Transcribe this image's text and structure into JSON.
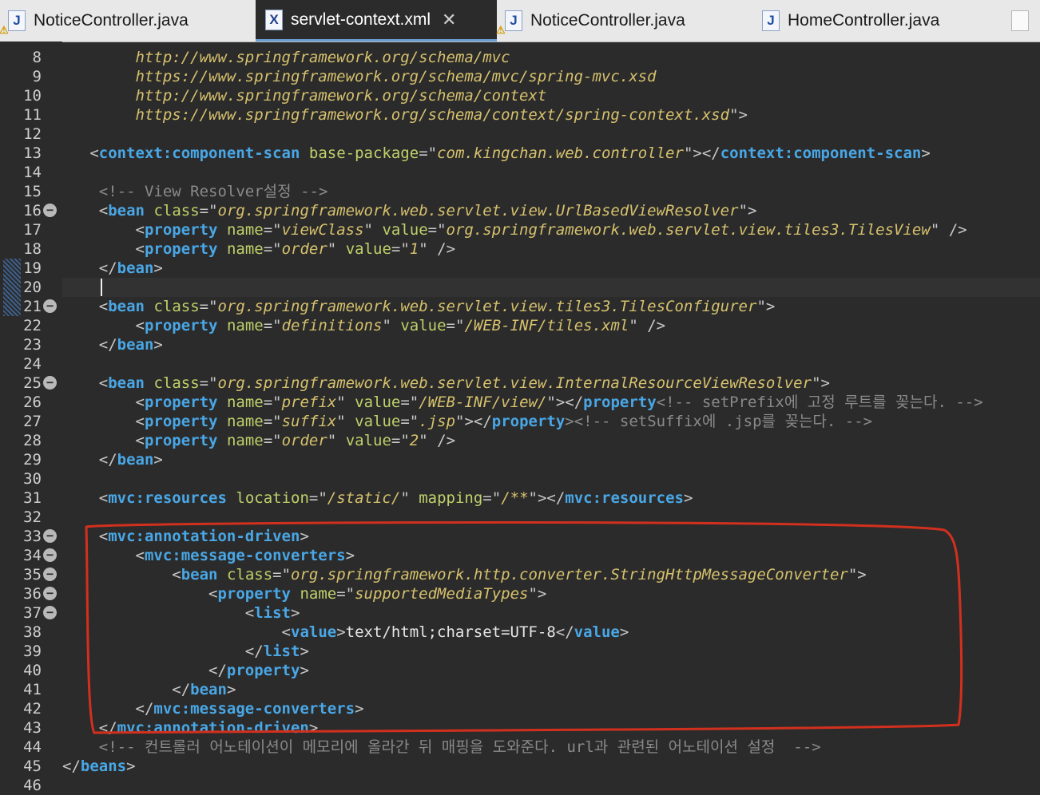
{
  "tabs": [
    {
      "label": "NoticeController.java",
      "icon": "java-file-icon"
    },
    {
      "label": "servlet-context.xml",
      "icon": "xml-file-icon"
    },
    {
      "label": "NoticeController.java",
      "icon": "java-file-icon"
    },
    {
      "label": "HomeController.java",
      "icon": "java-file-icon"
    }
  ],
  "active_tab_index": 1,
  "tab_icon_letters": {
    "java": "J",
    "xml": "X"
  },
  "close_glyph": "✕",
  "code_lines": [
    {
      "n": "8",
      "parts": [
        [
          "t",
          "        "
        ],
        [
          "v",
          "http://www.springframework.org/schema/mvc"
        ]
      ]
    },
    {
      "n": "9",
      "parts": [
        [
          "t",
          "        "
        ],
        [
          "v",
          "https://www.springframework.org/schema/mvc/spring-mvc.xsd"
        ]
      ]
    },
    {
      "n": "10",
      "parts": [
        [
          "t",
          "        "
        ],
        [
          "v",
          "http://www.springframework.org/schema/context"
        ]
      ]
    },
    {
      "n": "11",
      "parts": [
        [
          "t",
          "        "
        ],
        [
          "v",
          "https://www.springframework.org/schema/context/spring-context.xsd"
        ],
        [
          "b",
          "\">"
        ]
      ]
    },
    {
      "n": "12",
      "parts": []
    },
    {
      "n": "13",
      "parts": [
        [
          "t",
          "   "
        ],
        [
          "b",
          "<"
        ],
        [
          "g",
          "context:component-scan"
        ],
        [
          "t",
          " "
        ],
        [
          "a",
          "base-package"
        ],
        [
          "b",
          "=\""
        ],
        [
          "v",
          "com.kingchan.web.controller"
        ],
        [
          "b",
          "\"></"
        ],
        [
          "g",
          "context:component-scan"
        ],
        [
          "b",
          ">"
        ]
      ]
    },
    {
      "n": "14",
      "parts": []
    },
    {
      "n": "15",
      "parts": [
        [
          "t",
          "    "
        ],
        [
          "c",
          "<!-- View Resolver설정 -->"
        ]
      ]
    },
    {
      "n": "16",
      "fold": true,
      "parts": [
        [
          "t",
          "    "
        ],
        [
          "b",
          "<"
        ],
        [
          "g",
          "bean"
        ],
        [
          "t",
          " "
        ],
        [
          "a",
          "class"
        ],
        [
          "b",
          "=\""
        ],
        [
          "v",
          "org.springframework.web.servlet.view.UrlBasedViewResolver"
        ],
        [
          "b",
          "\">"
        ]
      ]
    },
    {
      "n": "17",
      "parts": [
        [
          "t",
          "        "
        ],
        [
          "b",
          "<"
        ],
        [
          "g",
          "property"
        ],
        [
          "t",
          " "
        ],
        [
          "a",
          "name"
        ],
        [
          "b",
          "=\""
        ],
        [
          "v",
          "viewClass"
        ],
        [
          "b",
          "\""
        ],
        [
          "t",
          " "
        ],
        [
          "a",
          "value"
        ],
        [
          "b",
          "=\""
        ],
        [
          "v",
          "org.springframework.web.servlet.view.tiles3.TilesView"
        ],
        [
          "b",
          "\" />"
        ]
      ]
    },
    {
      "n": "18",
      "parts": [
        [
          "t",
          "        "
        ],
        [
          "b",
          "<"
        ],
        [
          "g",
          "property"
        ],
        [
          "t",
          " "
        ],
        [
          "a",
          "name"
        ],
        [
          "b",
          "=\""
        ],
        [
          "v",
          "order"
        ],
        [
          "b",
          "\""
        ],
        [
          "t",
          " "
        ],
        [
          "a",
          "value"
        ],
        [
          "b",
          "=\""
        ],
        [
          "v",
          "1"
        ],
        [
          "b",
          "\" />"
        ]
      ]
    },
    {
      "n": "19",
      "parts": [
        [
          "t",
          "    "
        ],
        [
          "b",
          "</"
        ],
        [
          "g",
          "bean"
        ],
        [
          "b",
          ">"
        ]
      ]
    },
    {
      "n": "20",
      "cursor": true,
      "parts": []
    },
    {
      "n": "21",
      "fold": true,
      "parts": [
        [
          "t",
          "    "
        ],
        [
          "b",
          "<"
        ],
        [
          "g",
          "bean"
        ],
        [
          "t",
          " "
        ],
        [
          "a",
          "class"
        ],
        [
          "b",
          "=\""
        ],
        [
          "v",
          "org.springframework.web.servlet.view.tiles3.TilesConfigurer"
        ],
        [
          "b",
          "\">"
        ]
      ]
    },
    {
      "n": "22",
      "parts": [
        [
          "t",
          "        "
        ],
        [
          "b",
          "<"
        ],
        [
          "g",
          "property"
        ],
        [
          "t",
          " "
        ],
        [
          "a",
          "name"
        ],
        [
          "b",
          "=\""
        ],
        [
          "v",
          "definitions"
        ],
        [
          "b",
          "\""
        ],
        [
          "t",
          " "
        ],
        [
          "a",
          "value"
        ],
        [
          "b",
          "=\""
        ],
        [
          "v",
          "/WEB-INF/tiles.xml"
        ],
        [
          "b",
          "\" />"
        ]
      ]
    },
    {
      "n": "23",
      "parts": [
        [
          "t",
          "    "
        ],
        [
          "b",
          "</"
        ],
        [
          "g",
          "bean"
        ],
        [
          "b",
          ">"
        ]
      ]
    },
    {
      "n": "24",
      "parts": []
    },
    {
      "n": "25",
      "fold": true,
      "parts": [
        [
          "t",
          "    "
        ],
        [
          "b",
          "<"
        ],
        [
          "g",
          "bean"
        ],
        [
          "t",
          " "
        ],
        [
          "a",
          "class"
        ],
        [
          "b",
          "=\""
        ],
        [
          "v",
          "org.springframework.web.servlet.view.InternalResourceViewResolver"
        ],
        [
          "b",
          "\">"
        ]
      ]
    },
    {
      "n": "26",
      "parts": [
        [
          "t",
          "        "
        ],
        [
          "b",
          "<"
        ],
        [
          "g",
          "property"
        ],
        [
          "t",
          " "
        ],
        [
          "a",
          "name"
        ],
        [
          "b",
          "=\""
        ],
        [
          "v",
          "prefix"
        ],
        [
          "b",
          "\""
        ],
        [
          "t",
          " "
        ],
        [
          "a",
          "value"
        ],
        [
          "b",
          "=\""
        ],
        [
          "v",
          "/WEB-INF/view/"
        ],
        [
          "b",
          "\"></"
        ],
        [
          "g",
          "property"
        ],
        [
          "c",
          "<!-- setPrefix에 고정 루트를 꽂는다. -->"
        ]
      ]
    },
    {
      "n": "27",
      "parts": [
        [
          "t",
          "        "
        ],
        [
          "b",
          "<"
        ],
        [
          "g",
          "property"
        ],
        [
          "t",
          " "
        ],
        [
          "a",
          "name"
        ],
        [
          "b",
          "=\""
        ],
        [
          "v",
          "suffix"
        ],
        [
          "b",
          "\""
        ],
        [
          "t",
          " "
        ],
        [
          "a",
          "value"
        ],
        [
          "b",
          "=\""
        ],
        [
          "v",
          ".jsp"
        ],
        [
          "b",
          "\"></"
        ],
        [
          "g",
          "property"
        ],
        [
          "c",
          "><!-- setSuffix에 .jsp를 꽂는다. -->"
        ]
      ]
    },
    {
      "n": "28",
      "parts": [
        [
          "t",
          "        "
        ],
        [
          "b",
          "<"
        ],
        [
          "g",
          "property"
        ],
        [
          "t",
          " "
        ],
        [
          "a",
          "name"
        ],
        [
          "b",
          "=\""
        ],
        [
          "v",
          "order"
        ],
        [
          "b",
          "\""
        ],
        [
          "t",
          " "
        ],
        [
          "a",
          "value"
        ],
        [
          "b",
          "=\""
        ],
        [
          "v",
          "2"
        ],
        [
          "b",
          "\" />"
        ]
      ]
    },
    {
      "n": "29",
      "parts": [
        [
          "t",
          "    "
        ],
        [
          "b",
          "</"
        ],
        [
          "g",
          "bean"
        ],
        [
          "b",
          ">"
        ]
      ]
    },
    {
      "n": "30",
      "parts": []
    },
    {
      "n": "31",
      "parts": [
        [
          "t",
          "    "
        ],
        [
          "b",
          "<"
        ],
        [
          "g",
          "mvc:resources"
        ],
        [
          "t",
          " "
        ],
        [
          "a",
          "location"
        ],
        [
          "b",
          "=\""
        ],
        [
          "v",
          "/static/"
        ],
        [
          "b",
          "\""
        ],
        [
          "t",
          " "
        ],
        [
          "a",
          "mapping"
        ],
        [
          "b",
          "=\""
        ],
        [
          "v",
          "/**"
        ],
        [
          "b",
          "\"></"
        ],
        [
          "g",
          "mvc:resources"
        ],
        [
          "b",
          ">"
        ]
      ]
    },
    {
      "n": "32",
      "parts": []
    },
    {
      "n": "33",
      "fold": true,
      "parts": [
        [
          "t",
          "    "
        ],
        [
          "b",
          "<"
        ],
        [
          "g",
          "mvc:annotation-driven"
        ],
        [
          "b",
          ">"
        ]
      ]
    },
    {
      "n": "34",
      "fold": true,
      "parts": [
        [
          "t",
          "        "
        ],
        [
          "b",
          "<"
        ],
        [
          "g",
          "mvc:message-converters"
        ],
        [
          "b",
          ">"
        ]
      ]
    },
    {
      "n": "35",
      "fold": true,
      "parts": [
        [
          "t",
          "            "
        ],
        [
          "b",
          "<"
        ],
        [
          "g",
          "bean"
        ],
        [
          "t",
          " "
        ],
        [
          "a",
          "class"
        ],
        [
          "b",
          "=\""
        ],
        [
          "v",
          "org.springframework.http.converter.StringHttpMessageConverter"
        ],
        [
          "b",
          "\">"
        ]
      ]
    },
    {
      "n": "36",
      "fold": true,
      "parts": [
        [
          "t",
          "                "
        ],
        [
          "b",
          "<"
        ],
        [
          "g",
          "property"
        ],
        [
          "t",
          " "
        ],
        [
          "a",
          "name"
        ],
        [
          "b",
          "=\""
        ],
        [
          "v",
          "supportedMediaTypes"
        ],
        [
          "b",
          "\">"
        ]
      ]
    },
    {
      "n": "37",
      "fold": true,
      "parts": [
        [
          "t",
          "                    "
        ],
        [
          "b",
          "<"
        ],
        [
          "g",
          "list"
        ],
        [
          "b",
          ">"
        ]
      ]
    },
    {
      "n": "38",
      "parts": [
        [
          "t",
          "                        "
        ],
        [
          "b",
          "<"
        ],
        [
          "g",
          "value"
        ],
        [
          "b",
          ">"
        ],
        [
          "t",
          "text/html;charset=UTF-8"
        ],
        [
          "b",
          "</"
        ],
        [
          "g",
          "value"
        ],
        [
          "b",
          ">"
        ]
      ]
    },
    {
      "n": "39",
      "parts": [
        [
          "t",
          "                    "
        ],
        [
          "b",
          "</"
        ],
        [
          "g",
          "list"
        ],
        [
          "b",
          ">"
        ]
      ]
    },
    {
      "n": "40",
      "parts": [
        [
          "t",
          "                "
        ],
        [
          "b",
          "</"
        ],
        [
          "g",
          "property"
        ],
        [
          "b",
          ">"
        ]
      ]
    },
    {
      "n": "41",
      "parts": [
        [
          "t",
          "            "
        ],
        [
          "b",
          "</"
        ],
        [
          "g",
          "bean"
        ],
        [
          "b",
          ">"
        ]
      ]
    },
    {
      "n": "42",
      "parts": [
        [
          "t",
          "        "
        ],
        [
          "b",
          "</"
        ],
        [
          "g",
          "mvc:message-converters"
        ],
        [
          "b",
          ">"
        ]
      ]
    },
    {
      "n": "43",
      "parts": [
        [
          "t",
          "    "
        ],
        [
          "b",
          "</"
        ],
        [
          "g",
          "mvc:annotation-driven"
        ],
        [
          "b",
          ">"
        ]
      ]
    },
    {
      "n": "44",
      "parts": [
        [
          "t",
          "    "
        ],
        [
          "c",
          "<!-- 컨트롤러 어노테이션이 메모리에 올라간 뒤 매핑을 도와준다. url과 관련된 어노테이션 설정  -->"
        ]
      ]
    },
    {
      "n": "45",
      "parts": [
        [
          "b",
          "</"
        ],
        [
          "g",
          "beans"
        ],
        [
          "b",
          ">"
        ]
      ]
    },
    {
      "n": "46",
      "parts": []
    }
  ],
  "colors": {
    "background": "#2b2b2b",
    "tag": "#49a7e6",
    "attribute": "#bfd16a",
    "value": "#d6c16d",
    "comment": "#8a8a8a",
    "annotation": "#d2301e"
  }
}
